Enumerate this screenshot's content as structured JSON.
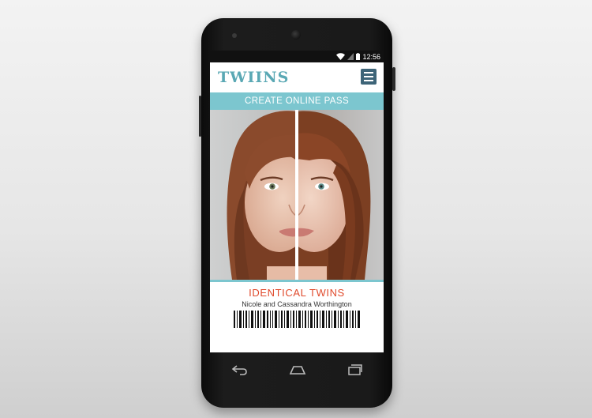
{
  "status_bar": {
    "time": "12:56"
  },
  "app": {
    "logo": "TWIINS"
  },
  "banner": {
    "label": "CREATE ONLINE PASS"
  },
  "pass": {
    "title": "IDENTICAL TWINS",
    "names": "Nicole and Cassandra Worthington"
  },
  "icons": {
    "wifi": "wifi-icon",
    "signal": "signal-icon",
    "battery": "battery-icon",
    "menu": "hamburger-menu-icon",
    "back": "back-icon",
    "home": "home-icon",
    "recents": "recents-icon"
  },
  "colors": {
    "brand_teal": "#7cc6cf",
    "logo_teal": "#5aa8b4",
    "menu_button": "#3d6478",
    "title_red": "#e04a2c"
  }
}
